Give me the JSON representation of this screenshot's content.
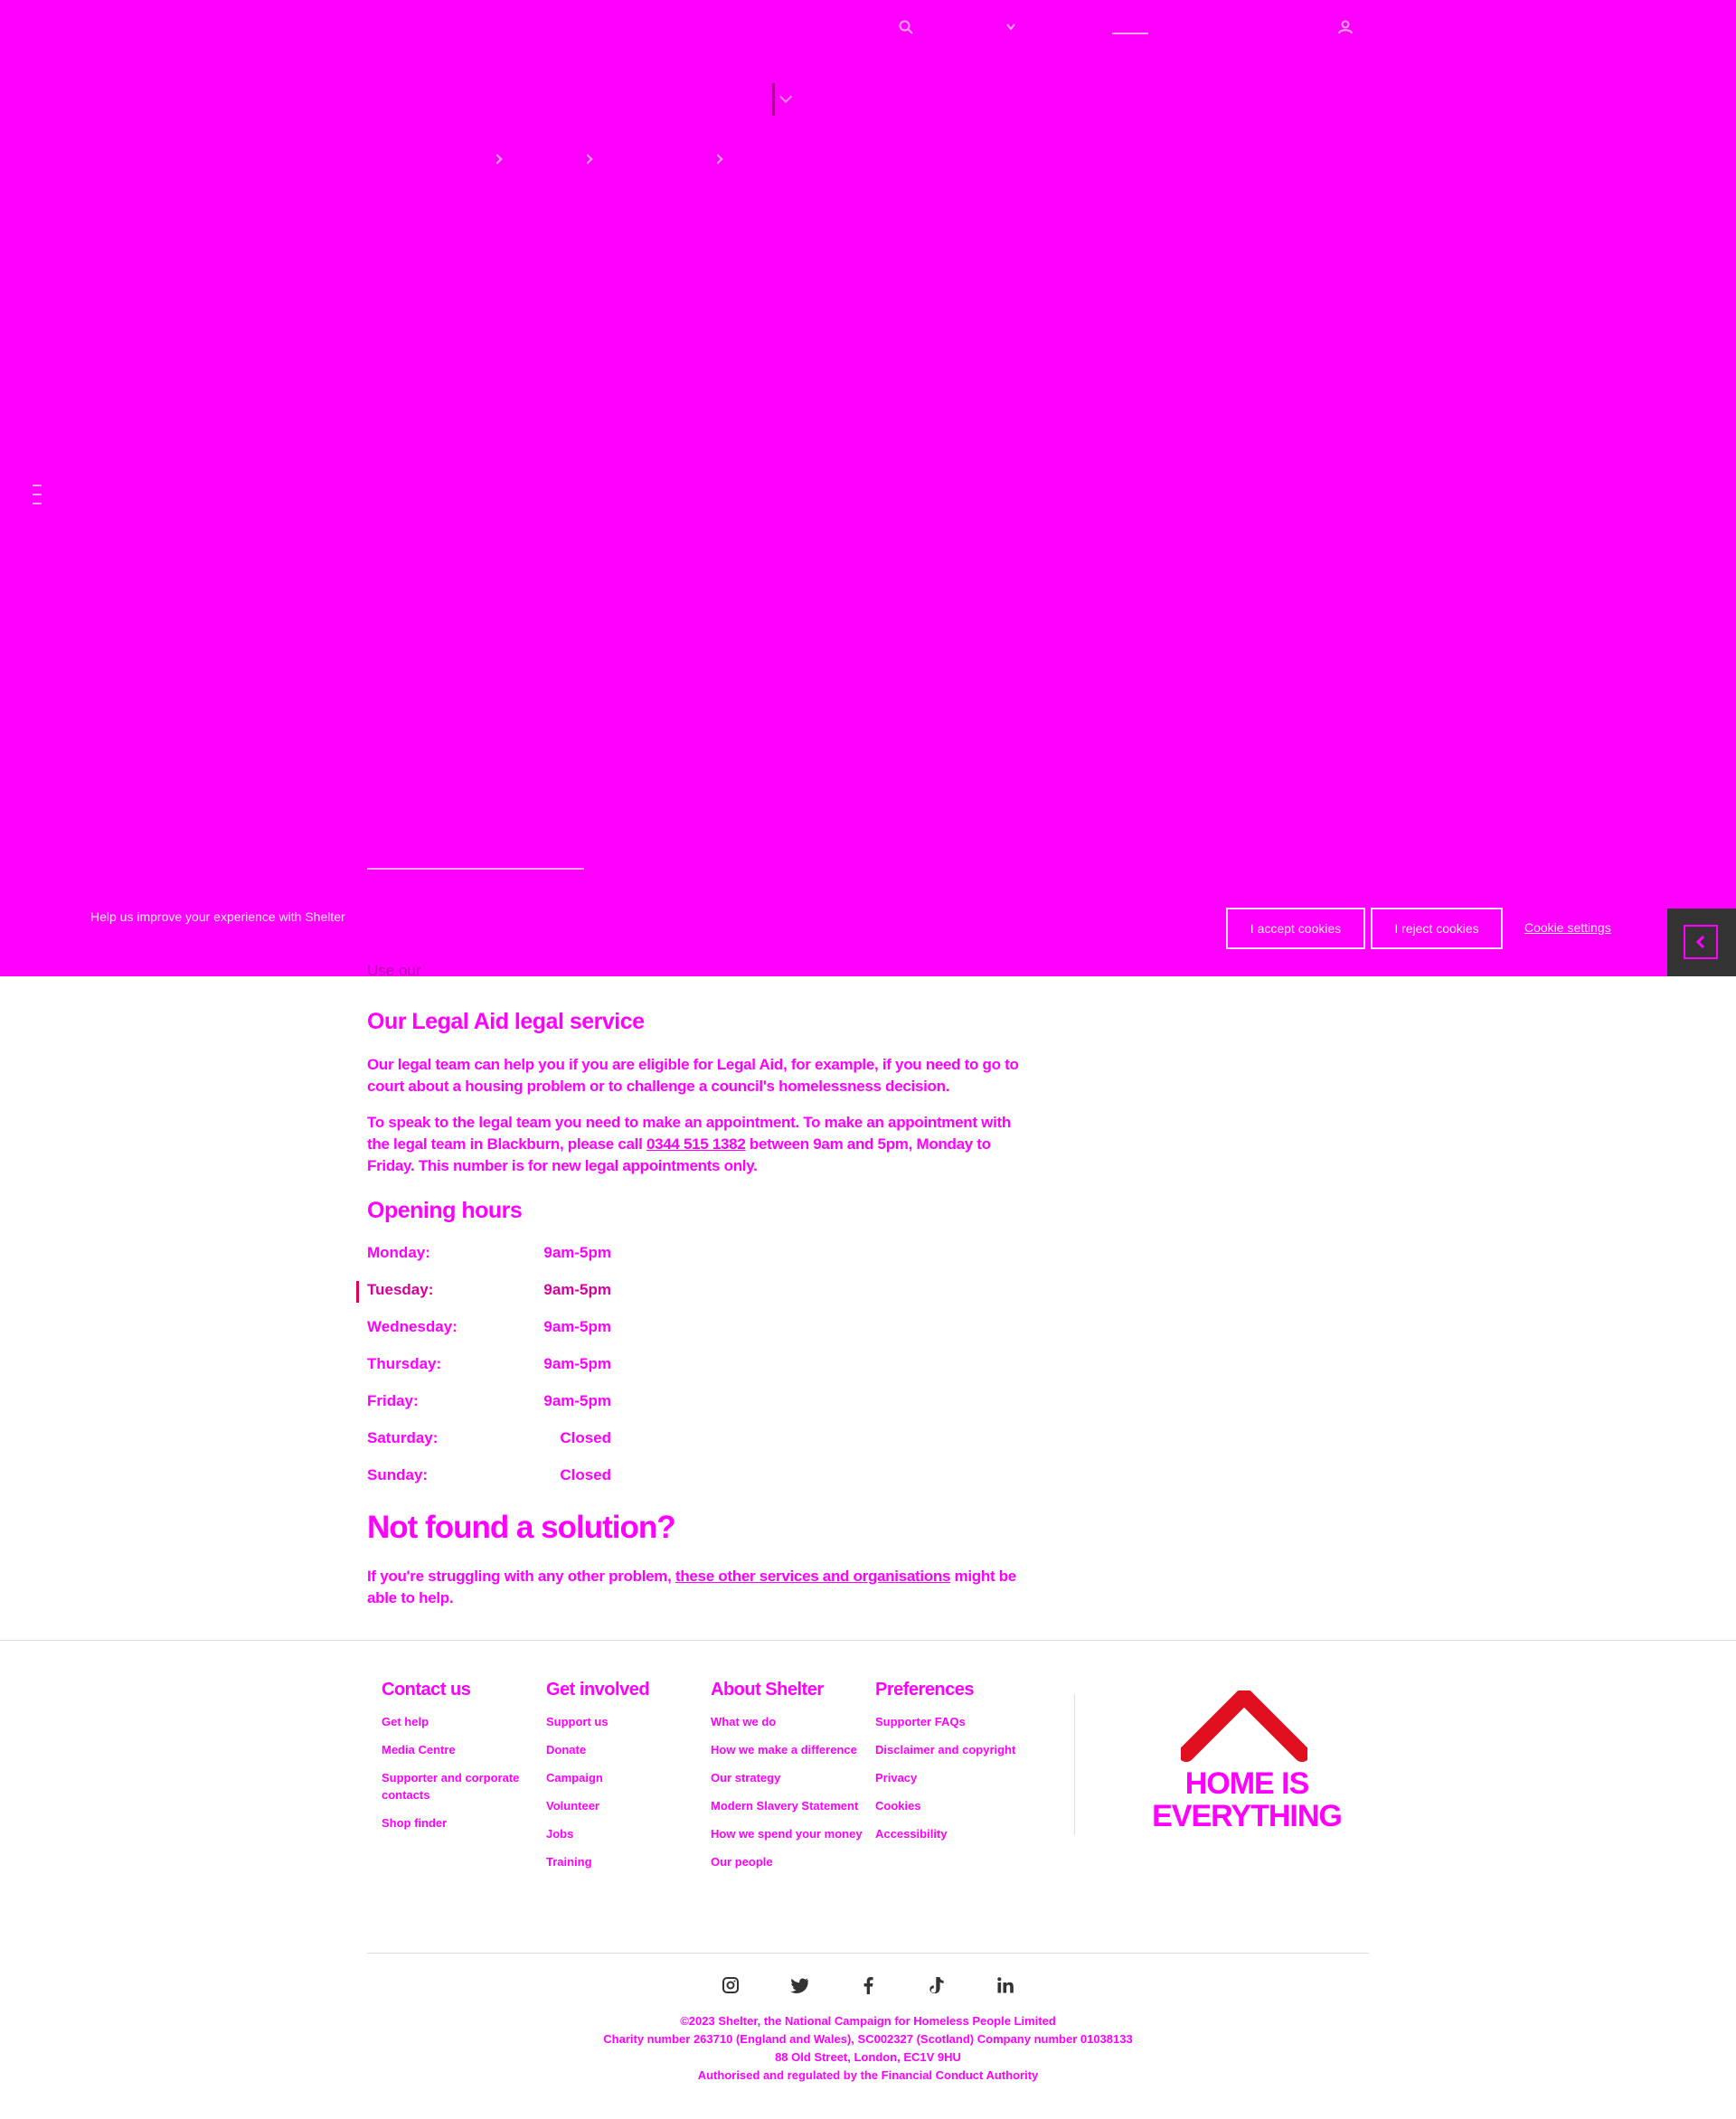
{
  "overlay": {
    "color": "#ff00ff"
  },
  "cookie_banner": {
    "message": "Help us improve your experience with Shelter",
    "accept_label": "I accept cookies",
    "reject_label": "I reject cookies",
    "settings_label": "Cookie settings"
  },
  "content": {
    "use_prefix": "Use our",
    "legal_heading": "Our Legal Aid legal service",
    "legal_para": "Our legal team can help you if you are eligible for Legal Aid, for example, if you need to go to court about a housing problem or to challenge a council's homelessness decision.",
    "appointment_para_before": "To speak to the legal team you need to make an appointment. To make an appointment with the legal team in Blackburn, please call ",
    "appointment_phone": "0344 515 1382",
    "appointment_para_after": " between 9am and 5pm, Monday to Friday. This number is for new legal appointments only.",
    "hours_heading": "Opening hours",
    "hours": [
      {
        "day": "Monday:",
        "time": "9am-5pm"
      },
      {
        "day": "Tuesday:",
        "time": "9am-5pm"
      },
      {
        "day": "Wednesday:",
        "time": "9am-5pm"
      },
      {
        "day": "Thursday:",
        "time": "9am-5pm"
      },
      {
        "day": "Friday:",
        "time": "9am-5pm"
      },
      {
        "day": "Saturday:",
        "time": "Closed"
      },
      {
        "day": "Sunday:",
        "time": "Closed"
      }
    ],
    "not_found_heading": "Not found a solution?",
    "not_found_before": "If you're struggling with any other problem, ",
    "not_found_link": "these other services and organisations",
    "not_found_after": " might be able to help."
  },
  "footer": {
    "contact": {
      "title": "Contact us",
      "links": [
        "Get help",
        "Media Centre",
        "Supporter and corporate contacts",
        "Shop finder"
      ]
    },
    "involved": {
      "title": "Get involved",
      "links": [
        "Support us",
        "Donate",
        "Campaign",
        "Volunteer",
        "Jobs",
        "Training"
      ]
    },
    "about": {
      "title": "About Shelter",
      "links": [
        "What we do",
        "How we make a difference",
        "Our strategy",
        "Modern Slavery Statement",
        "How we spend your money",
        "Our people"
      ]
    },
    "preferences": {
      "title": "Preferences",
      "links": [
        "Supporter FAQs",
        "Disclaimer and copyright",
        "Privacy",
        "Cookies",
        "Accessibility"
      ]
    },
    "logo_line1": "HOME IS",
    "logo_line2": "EVERYTHING",
    "social": [
      "instagram-icon",
      "twitter-icon",
      "facebook-icon",
      "tiktok-icon",
      "linkedin-icon"
    ],
    "legal": [
      "©2023 Shelter, the National Campaign for Homeless People Limited",
      "Charity number 263710 (England and Wales), SC002327 (Scotland) Company number 01038133",
      "88 Old Street, London, EC1V 9HU",
      "Authorised and regulated by the Financial Conduct Authority"
    ]
  }
}
